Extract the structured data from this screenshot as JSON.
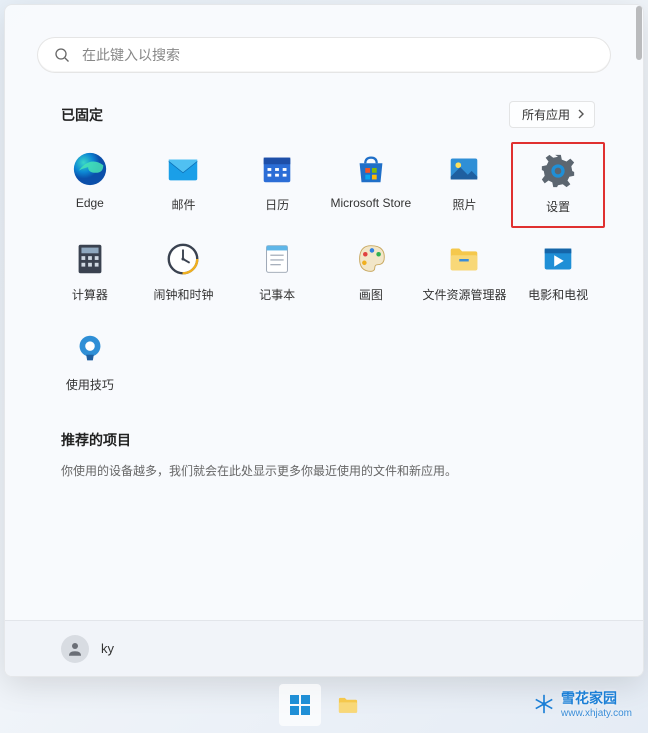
{
  "search": {
    "placeholder": "在此键入以搜索"
  },
  "pinned": {
    "title": "已固定",
    "all_apps_label": "所有应用",
    "apps": [
      {
        "name": "Edge",
        "icon": "edge-icon"
      },
      {
        "name": "邮件",
        "icon": "mail-icon"
      },
      {
        "name": "日历",
        "icon": "calendar-icon"
      },
      {
        "name": "Microsoft Store",
        "icon": "store-icon"
      },
      {
        "name": "照片",
        "icon": "photos-icon"
      },
      {
        "name": "设置",
        "icon": "settings-icon",
        "highlighted": true
      },
      {
        "name": "计算器",
        "icon": "calculator-icon"
      },
      {
        "name": "闹钟和时钟",
        "icon": "clock-icon"
      },
      {
        "name": "记事本",
        "icon": "notepad-icon"
      },
      {
        "name": "画图",
        "icon": "paint-icon"
      },
      {
        "name": "文件资源管理器",
        "icon": "explorer-icon"
      },
      {
        "name": "电影和电视",
        "icon": "movies-icon"
      },
      {
        "name": "使用技巧",
        "icon": "tips-icon"
      }
    ]
  },
  "recommended": {
    "title": "推荐的项目",
    "text": "你使用的设备越多，我们就会在此处显示更多你最近使用的文件和新应用。"
  },
  "user": {
    "name": "ky"
  },
  "watermark": {
    "title": "雪花家园",
    "url": "www.xhjaty.com"
  },
  "colors": {
    "highlight_border": "#e03030",
    "accent": "#1b7fd6"
  }
}
